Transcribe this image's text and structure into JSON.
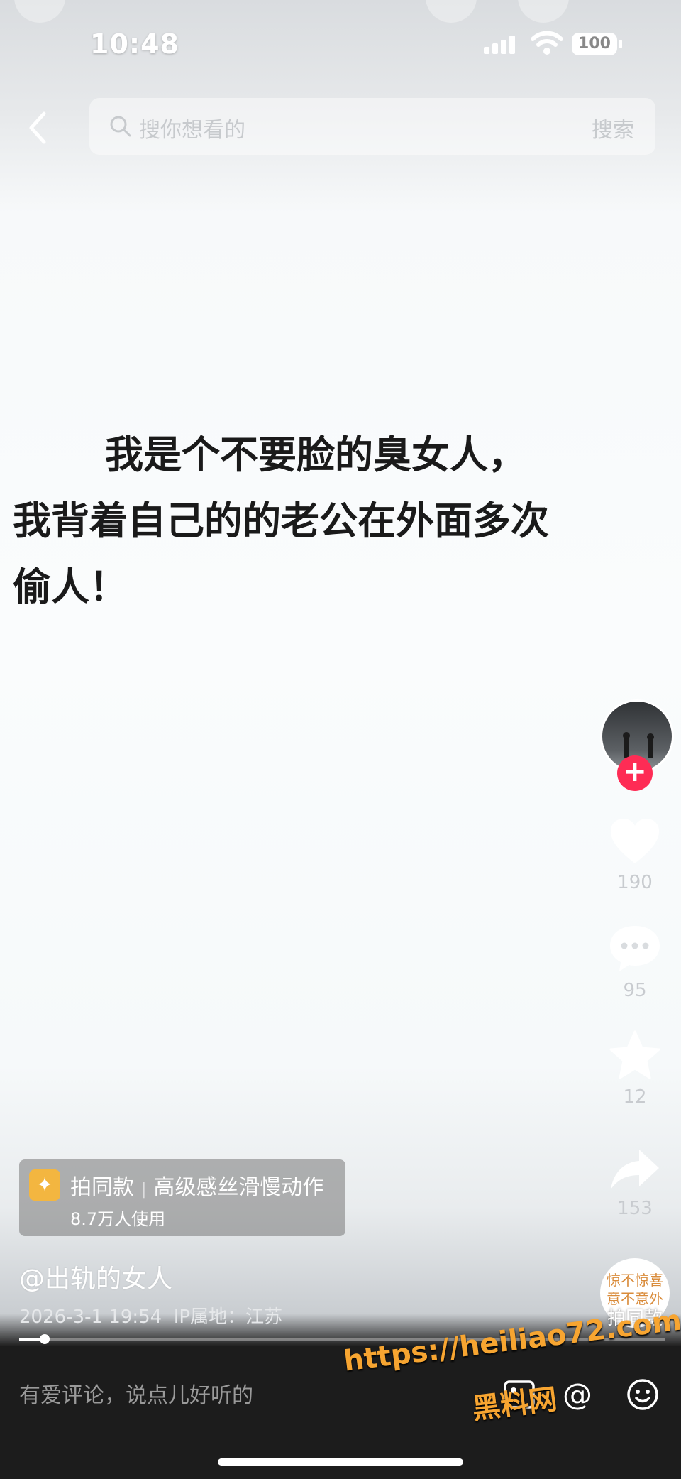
{
  "status_bar": {
    "time": "10:48",
    "battery": "100"
  },
  "search": {
    "placeholder": "搜你想看的",
    "button": "搜索"
  },
  "caption": {
    "line1": "我是个不要脸的臭女人，",
    "line2": "我背着自己的的老公在外面多次",
    "line3": "偷人！"
  },
  "actions": {
    "likes": "190",
    "comments": "95",
    "favorites": "12",
    "shares": "153"
  },
  "template_card": {
    "label": "拍同款",
    "name": "高级感丝滑慢动作",
    "usage": "8.7万人使用"
  },
  "video": {
    "author": "@出轨的女人",
    "date": "2026-3-1 19:54",
    "location": "IP属地：江苏",
    "progress": 0.04
  },
  "same_button": {
    "art_text": "惊不惊喜 意不意外",
    "label": "拍同款"
  },
  "comment_bar": {
    "placeholder": "有爱评论，说点儿好听的"
  },
  "watermark": {
    "url": "https://heiliao72.com",
    "name": "黑料网"
  },
  "colors": {
    "follow_red": "#fe2c55",
    "watermark_orange": "#f7a531",
    "template_icon": "#f3b640"
  }
}
